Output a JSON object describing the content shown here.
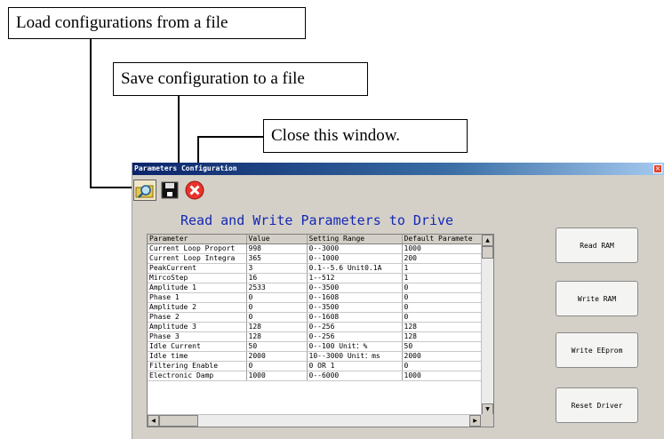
{
  "callouts": {
    "load": "Load configurations from a file",
    "save": "Save configuration to a file",
    "close": "Close this window."
  },
  "window": {
    "title": "Parameters Configuration",
    "close_glyph": "×"
  },
  "toolbar": {
    "load_icon": "folder-search-icon",
    "save_icon": "floppy-save-icon",
    "close_icon": "red-x-circle-icon"
  },
  "heading": "Read and Write Parameters to Drive",
  "table": {
    "columns": [
      "Parameter",
      "Value",
      "Setting Range",
      "Default Paramete"
    ],
    "rows": [
      [
        "Current Loop Proport",
        "998",
        "0--3000",
        "1000"
      ],
      [
        "Current Loop Integra",
        "365",
        "0--1000",
        "200"
      ],
      [
        "PeakCurrent",
        "3",
        "0.1--5.6 Unit0.1A",
        "1"
      ],
      [
        "MircoStep",
        "16",
        "1--512",
        "1"
      ],
      [
        "Amplitude 1",
        "2533",
        "0--3500",
        "0"
      ],
      [
        "Phase 1",
        "0",
        "0--1608",
        "0"
      ],
      [
        "Amplitude 2",
        "0",
        "0--3500",
        "0"
      ],
      [
        "Phase 2",
        "0",
        "0--1608",
        "0"
      ],
      [
        "Amplitude 3",
        "128",
        "0--256",
        "128"
      ],
      [
        "Phase 3",
        "128",
        "0--256",
        "128"
      ],
      [
        "Idle Current",
        "50",
        "0--100 Unit：%",
        "50"
      ],
      [
        "Idle time",
        "2000",
        "10--3000 Unit：ms",
        "2000"
      ],
      [
        "Filtering Enable",
        "0",
        "0 OR 1",
        "0"
      ],
      [
        "Electronic Damp",
        "1000",
        "0--6000",
        "1000"
      ]
    ]
  },
  "scroll": {
    "up": "▲",
    "down": "▼",
    "left": "◀",
    "right": "▶"
  },
  "buttons": {
    "read_ram": "Read RAM",
    "write_ram": "Write RAM",
    "write_eeprom": "Write EEprom",
    "reset_driver": "Reset Driver"
  }
}
